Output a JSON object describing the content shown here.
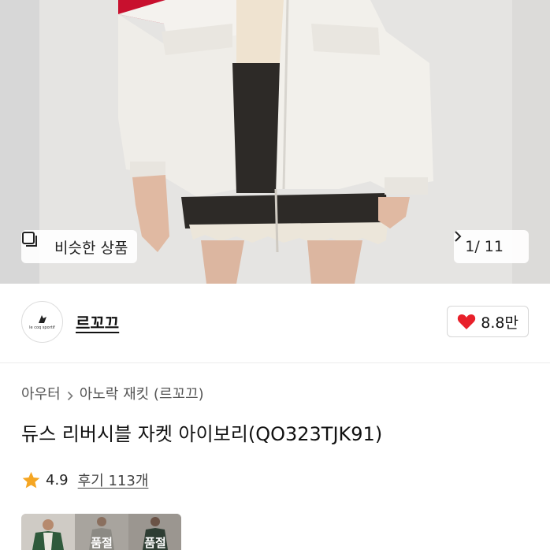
{
  "hero": {
    "similar_label": "비슷한 상품",
    "counter": "1/ 11"
  },
  "shop": {
    "logo_text": "le coq sportif",
    "name": "르꼬끄",
    "likes": "8.8만"
  },
  "product": {
    "breadcrumb": [
      "아우터",
      "아노락 재킷 (르꼬끄)"
    ],
    "title": "듀스 리버시블 자켓 아이보리(QO323TJK91)",
    "rating": "4.9",
    "reviews": "후기 113개"
  },
  "thumbnails": [
    {
      "label": ""
    },
    {
      "label": "품절"
    },
    {
      "label": "품절"
    }
  ],
  "colors": {
    "heart": "#e8202a",
    "star": "#f5a623"
  }
}
